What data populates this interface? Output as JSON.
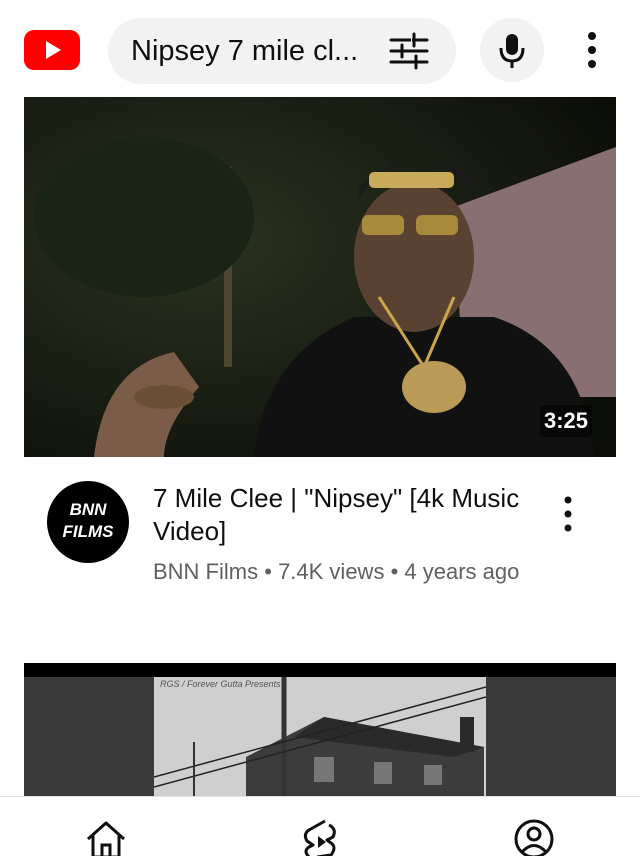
{
  "header": {
    "logo_icon": "youtube-logo-icon",
    "search_query": "Nipsey 7 mile cl...",
    "filter_icon": "filter-sliders-icon",
    "mic_icon": "microphone-icon",
    "more_icon": "more-vertical-icon",
    "brand_color": "#ff0000"
  },
  "videos": [
    {
      "duration": "3:25",
      "channel_avatar_text": "BNN\nFILMS",
      "title": "7 Mile Clee | \"Nipsey\" [4k Music Video]",
      "channel": "BNN Films",
      "views": "7.4K views",
      "age": "4 years ago",
      "separator": "•"
    },
    {
      "thumbnail_caption": "RGS / Forever Gutta Presents"
    }
  ],
  "bottom_nav": [
    {
      "icon": "home-icon"
    },
    {
      "icon": "shorts-icon"
    },
    {
      "icon": "account-icon"
    }
  ]
}
